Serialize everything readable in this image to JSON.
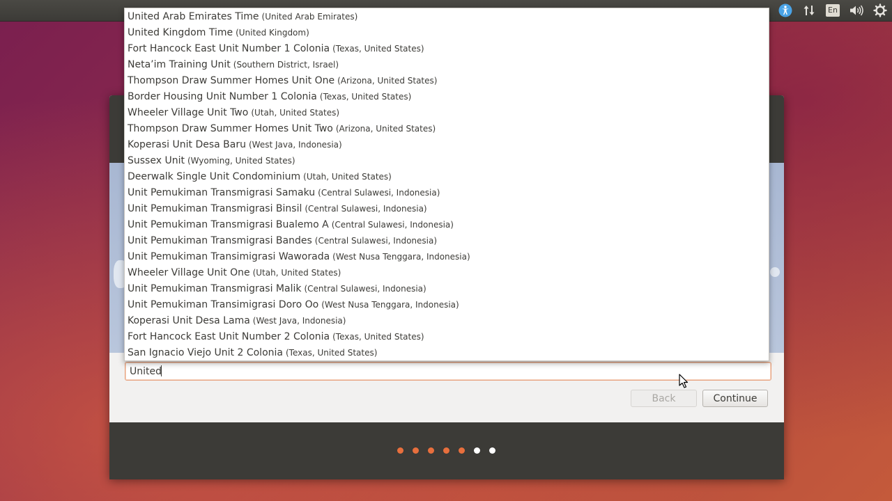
{
  "panel": {
    "icons": [
      "accessibility-icon",
      "network-arrows-icon",
      "keyboard-layout-indicator",
      "volume-icon",
      "settings-gear-icon"
    ],
    "keyboard_layout": "En"
  },
  "timezone": {
    "input_value": "United",
    "suggestions": [
      {
        "name": "United Arab Emirates Time",
        "region": "(United Arab Emirates)"
      },
      {
        "name": "United Kingdom Time",
        "region": "(United Kingdom)"
      },
      {
        "name": "Fort Hancock East Unit Number 1 Colonia",
        "region": "(Texas, United States)"
      },
      {
        "name": "Neta’im Training Unit",
        "region": "(Southern District, Israel)"
      },
      {
        "name": "Thompson Draw Summer Homes Unit One",
        "region": "(Arizona, United States)"
      },
      {
        "name": "Border Housing Unit Number 1 Colonia",
        "region": "(Texas, United States)"
      },
      {
        "name": "Wheeler Village Unit Two",
        "region": "(Utah, United States)"
      },
      {
        "name": "Thompson Draw Summer Homes Unit Two",
        "region": "(Arizona, United States)"
      },
      {
        "name": "Koperasi Unit Desa Baru",
        "region": "(West Java, Indonesia)"
      },
      {
        "name": "Sussex Unit",
        "region": "(Wyoming, United States)"
      },
      {
        "name": "Deerwalk Single Unit Condominium",
        "region": "(Utah, United States)"
      },
      {
        "name": "Unit Pemukiman Transmigrasi Samaku",
        "region": "(Central Sulawesi, Indonesia)"
      },
      {
        "name": "Unit Pemukiman Transmigrasi Binsil",
        "region": "(Central Sulawesi, Indonesia)"
      },
      {
        "name": "Unit Pemukiman Transmigrasi Bualemo A",
        "region": "(Central Sulawesi, Indonesia)"
      },
      {
        "name": "Unit Pemukiman Transmigrasi Bandes",
        "region": "(Central Sulawesi, Indonesia)"
      },
      {
        "name": "Unit Pemukiman Transimigrasi Waworada",
        "region": "(West Nusa Tenggara, Indonesia)"
      },
      {
        "name": "Wheeler Village Unit One",
        "region": "(Utah, United States)"
      },
      {
        "name": "Unit Pemukiman Transmigrasi Malik",
        "region": "(Central Sulawesi, Indonesia)"
      },
      {
        "name": "Unit Pemukiman Transimigrasi Doro Oo",
        "region": "(West Nusa Tenggara, Indonesia)"
      },
      {
        "name": "Koperasi Unit Desa Lama",
        "region": "(West Java, Indonesia)"
      },
      {
        "name": "Fort Hancock East Unit Number 2 Colonia",
        "region": "(Texas, United States)"
      },
      {
        "name": "San Ignacio Viejo Unit 2 Colonia",
        "region": "(Texas, United States)"
      }
    ]
  },
  "buttons": {
    "back_label": "Back",
    "continue_label": "Continue"
  },
  "progress": {
    "total_steps": 7,
    "completed_steps": 5
  },
  "colors": {
    "accent": "#e86f3d",
    "panel": "#3c3b37"
  }
}
